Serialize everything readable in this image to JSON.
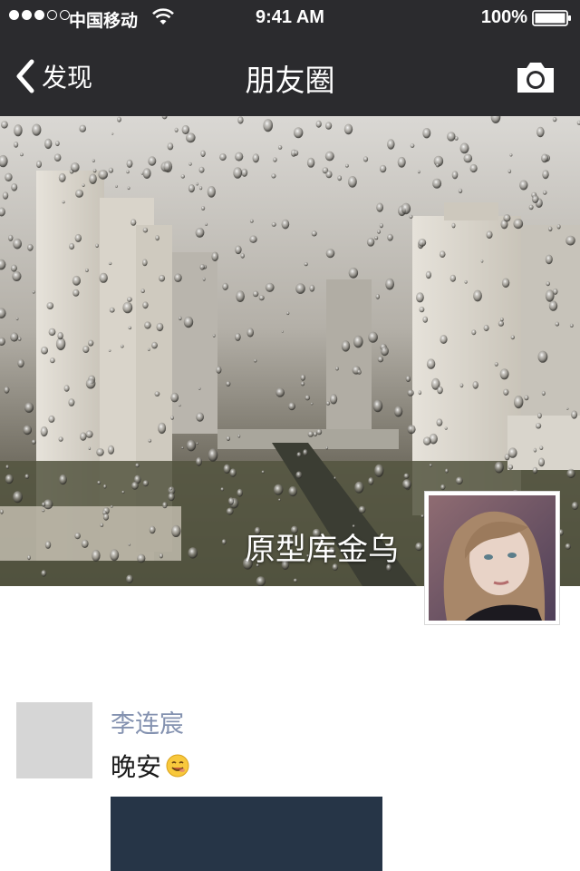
{
  "status_bar": {
    "carrier": "中国移动",
    "time": "9:41 AM",
    "battery": "100%"
  },
  "nav": {
    "back_label": "发现",
    "title": "朋友圈"
  },
  "cover": {
    "owner_name": "原型库金乌"
  },
  "feed": [
    {
      "author": "李连宸",
      "text": "晚安",
      "emoji": "smiling-face"
    }
  ],
  "colors": {
    "bar_background": "#2b2b2e",
    "author_link": "#8492b0",
    "image_placeholder": "#263547"
  }
}
